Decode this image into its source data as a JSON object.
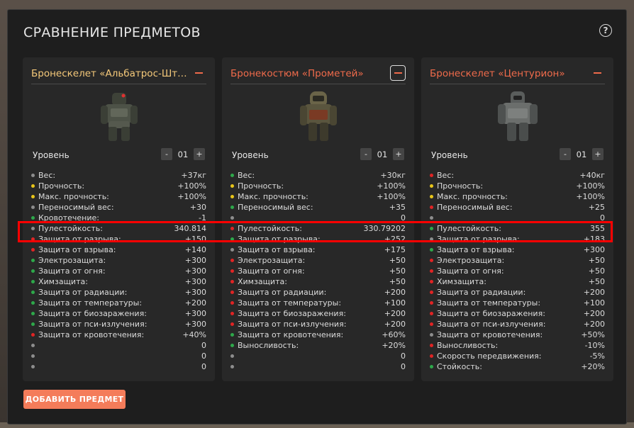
{
  "title": "СРАВНЕНИЕ ПРЕДМЕТОВ",
  "help_icon": "question-icon",
  "add_button": "ДОБАВИТЬ ПРЕДМЕТ",
  "colors": {
    "gray": "#8d8d8d",
    "yellow": "#e8c51a",
    "red": "#e02424",
    "green": "#2ea84a",
    "accent": "#f47c5a",
    "highlight": "#ff0000"
  },
  "cards": [
    {
      "name": "Бронескелет «Альбатрос-Штурмовик»",
      "name_color": "#f5c97a",
      "level_label": "Уровень",
      "level_value": "01",
      "minus": "-",
      "plus": "+",
      "stats": [
        {
          "name": "Вес:",
          "value": "+37кг",
          "dot": "gray"
        },
        {
          "name": "Прочность:",
          "value": "+100%",
          "dot": "yellow"
        },
        {
          "name": "Макс. прочность:",
          "value": "+100%",
          "dot": "yellow"
        },
        {
          "name": "Переносимый вес:",
          "value": "+30",
          "dot": "gray"
        },
        {
          "name": "Кровотечение:",
          "value": "-1",
          "dot": "green"
        },
        {
          "name": "Пулестойкость:",
          "value": "340.814",
          "dot": "gray"
        },
        {
          "name": "Защита от разрыва:",
          "value": "+150",
          "dot": "red"
        },
        {
          "name": "Защита от взрыва:",
          "value": "+140",
          "dot": "red"
        },
        {
          "name": "Электрозащита:",
          "value": "+300",
          "dot": "green"
        },
        {
          "name": "Защита от огня:",
          "value": "+300",
          "dot": "green"
        },
        {
          "name": "Химзащита:",
          "value": "+300",
          "dot": "green"
        },
        {
          "name": "Защита от радиации:",
          "value": "+300",
          "dot": "green"
        },
        {
          "name": "Защита от температуры:",
          "value": "+200",
          "dot": "green"
        },
        {
          "name": "Защита от биозаражения:",
          "value": "+300",
          "dot": "green"
        },
        {
          "name": "Защита от пси-излучения:",
          "value": "+300",
          "dot": "green"
        },
        {
          "name": "Защита от кровотечения:",
          "value": "+40%",
          "dot": "red"
        },
        {
          "name": "",
          "value": "0",
          "dot": "gray"
        },
        {
          "name": "",
          "value": "0",
          "dot": "gray"
        },
        {
          "name": "",
          "value": "0",
          "dot": "gray"
        }
      ]
    },
    {
      "name": "Бронекостюм «Прометей»",
      "name_color": "#f06b4b",
      "level_label": "Уровень",
      "level_value": "01",
      "minus": "-",
      "plus": "+",
      "stats": [
        {
          "name": "Вес:",
          "value": "+30кг",
          "dot": "green"
        },
        {
          "name": "Прочность:",
          "value": "+100%",
          "dot": "yellow"
        },
        {
          "name": "Макс. прочность:",
          "value": "+100%",
          "dot": "yellow"
        },
        {
          "name": "Переносимый вес:",
          "value": "+35",
          "dot": "green"
        },
        {
          "name": "",
          "value": "0",
          "dot": "gray"
        },
        {
          "name": "Пулестойкость:",
          "value": "330.79202",
          "dot": "red"
        },
        {
          "name": "Защита от разрыва:",
          "value": "+252",
          "dot": "green"
        },
        {
          "name": "Защита от взрыва:",
          "value": "+175",
          "dot": "gray"
        },
        {
          "name": "Электрозащита:",
          "value": "+50",
          "dot": "red"
        },
        {
          "name": "Защита от огня:",
          "value": "+50",
          "dot": "red"
        },
        {
          "name": "Химзащита:",
          "value": "+50",
          "dot": "red"
        },
        {
          "name": "Защита от радиации:",
          "value": "+200",
          "dot": "red"
        },
        {
          "name": "Защита от температуры:",
          "value": "+100",
          "dot": "red"
        },
        {
          "name": "Защита от биозаражения:",
          "value": "+200",
          "dot": "red"
        },
        {
          "name": "Защита от пси-излучения:",
          "value": "+200",
          "dot": "red"
        },
        {
          "name": "Защита от кровотечения:",
          "value": "+60%",
          "dot": "green"
        },
        {
          "name": "Выносливость:",
          "value": "+20%",
          "dot": "green"
        },
        {
          "name": "",
          "value": "0",
          "dot": "gray"
        },
        {
          "name": "",
          "value": "0",
          "dot": "gray"
        }
      ]
    },
    {
      "name": "Бронескелет «Центурион»",
      "name_color": "#f06b4b",
      "level_label": "Уровень",
      "level_value": "01",
      "minus": "-",
      "plus": "+",
      "stats": [
        {
          "name": "Вес:",
          "value": "+40кг",
          "dot": "red"
        },
        {
          "name": "Прочность:",
          "value": "+100%",
          "dot": "yellow"
        },
        {
          "name": "Макс. прочность:",
          "value": "+100%",
          "dot": "yellow"
        },
        {
          "name": "Переносимый вес:",
          "value": "+25",
          "dot": "red"
        },
        {
          "name": "",
          "value": "0",
          "dot": "gray"
        },
        {
          "name": "Пулестойкость:",
          "value": "355",
          "dot": "green"
        },
        {
          "name": "Защита от разрыва:",
          "value": "+183",
          "dot": "gray"
        },
        {
          "name": "Защита от взрыва:",
          "value": "+300",
          "dot": "green"
        },
        {
          "name": "Электрозащита:",
          "value": "+50",
          "dot": "red"
        },
        {
          "name": "Защита от огня:",
          "value": "+50",
          "dot": "red"
        },
        {
          "name": "Химзащита:",
          "value": "+50",
          "dot": "red"
        },
        {
          "name": "Защита от радиации:",
          "value": "+200",
          "dot": "red"
        },
        {
          "name": "Защита от температуры:",
          "value": "+100",
          "dot": "red"
        },
        {
          "name": "Защита от биозаражения:",
          "value": "+200",
          "dot": "red"
        },
        {
          "name": "Защита от пси-излучения:",
          "value": "+200",
          "dot": "red"
        },
        {
          "name": "Защита от кровотечения:",
          "value": "+50%",
          "dot": "gray"
        },
        {
          "name": "Выносливость:",
          "value": "-10%",
          "dot": "red"
        },
        {
          "name": "Скорость передвижения:",
          "value": "-5%",
          "dot": "red"
        },
        {
          "name": "Стойкость:",
          "value": "+20%",
          "dot": "green"
        }
      ]
    }
  ]
}
